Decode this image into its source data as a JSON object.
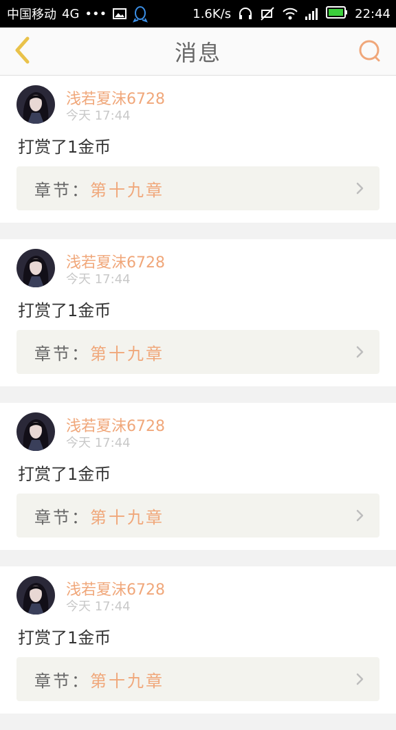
{
  "status_bar": {
    "carrier": "中国移动",
    "network": "4G",
    "dots": "•••",
    "speed": "1.6K/s",
    "time": "22:44"
  },
  "header": {
    "title": "消息",
    "back_icon": "chevron-left-icon",
    "search_icon": "search-icon"
  },
  "colors": {
    "accent": "#f0a77a",
    "back_arrow": "#e9c24a"
  },
  "messages": [
    {
      "username": "浅若夏沫6728",
      "time": "今天  17:44",
      "text": "打赏了1金币",
      "chapter_label": "章节：",
      "chapter_value": "第十九章"
    },
    {
      "username": "浅若夏沫6728",
      "time": "今天  17:44",
      "text": "打赏了1金币",
      "chapter_label": "章节：",
      "chapter_value": "第十九章"
    },
    {
      "username": "浅若夏沫6728",
      "time": "今天  17:44",
      "text": "打赏了1金币",
      "chapter_label": "章节：",
      "chapter_value": "第十九章"
    },
    {
      "username": "浅若夏沫6728",
      "time": "今天  17:44",
      "text": "打赏了1金币",
      "chapter_label": "章节：",
      "chapter_value": "第十九章"
    }
  ]
}
